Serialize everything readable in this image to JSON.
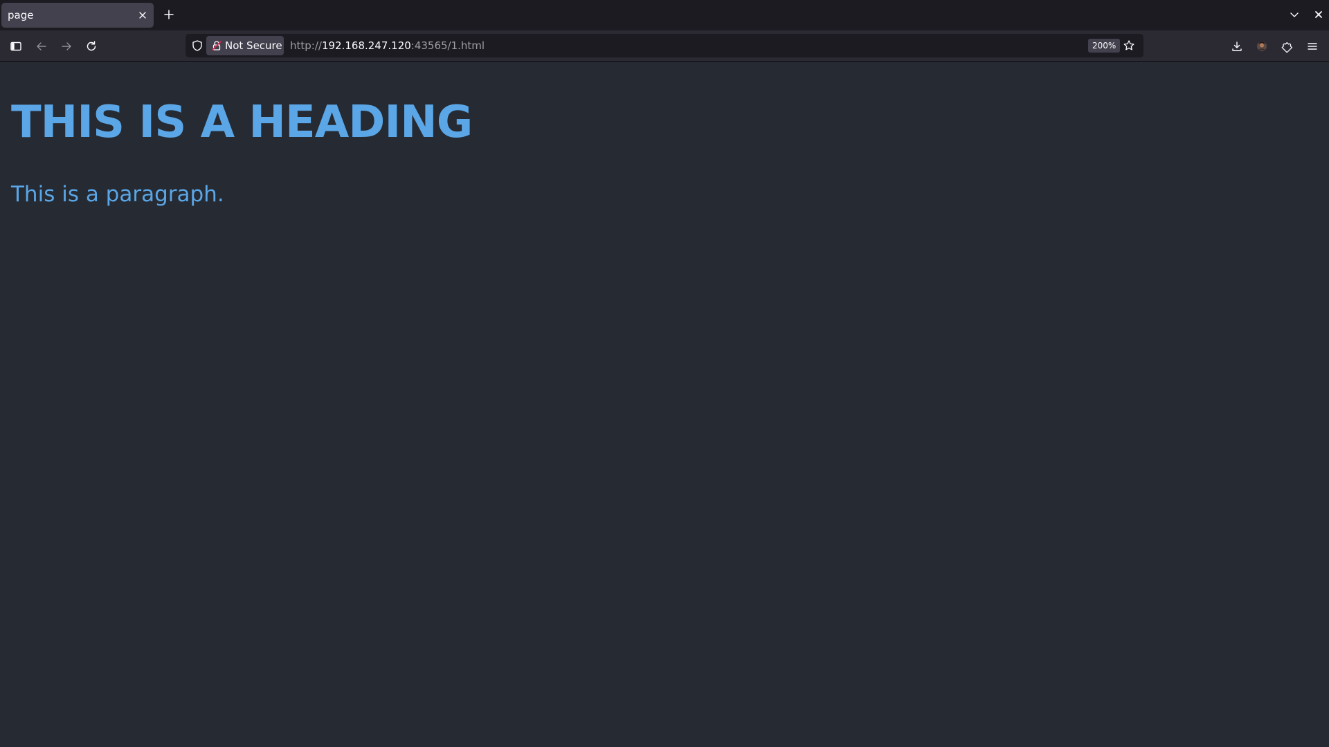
{
  "browser": {
    "tab": {
      "title": "page"
    },
    "urlbar": {
      "security_label": "Not Secure",
      "url_scheme": "http://",
      "url_host": "192.168.247.120",
      "url_rest": ":43565/1.html",
      "zoom": "200%"
    },
    "icons": {
      "sidebar": "sidebar-icon",
      "back": "back-arrow-icon",
      "forward": "forward-arrow-icon",
      "reload": "reload-icon",
      "shield": "shield-icon",
      "lock": "lock-icon",
      "bookmark": "star-icon",
      "downloads": "download-icon",
      "account": "avatar",
      "extensions": "puzzle-icon",
      "menu": "hamburger-menu-icon"
    }
  },
  "page": {
    "heading": "THIS IS A HEADING",
    "paragraph": "This is a paragraph."
  },
  "colors": {
    "page_background": "#262a33",
    "text_accent": "#5aa6e6",
    "chrome_dark": "#1c1b22",
    "toolbar": "#2b2a33"
  }
}
